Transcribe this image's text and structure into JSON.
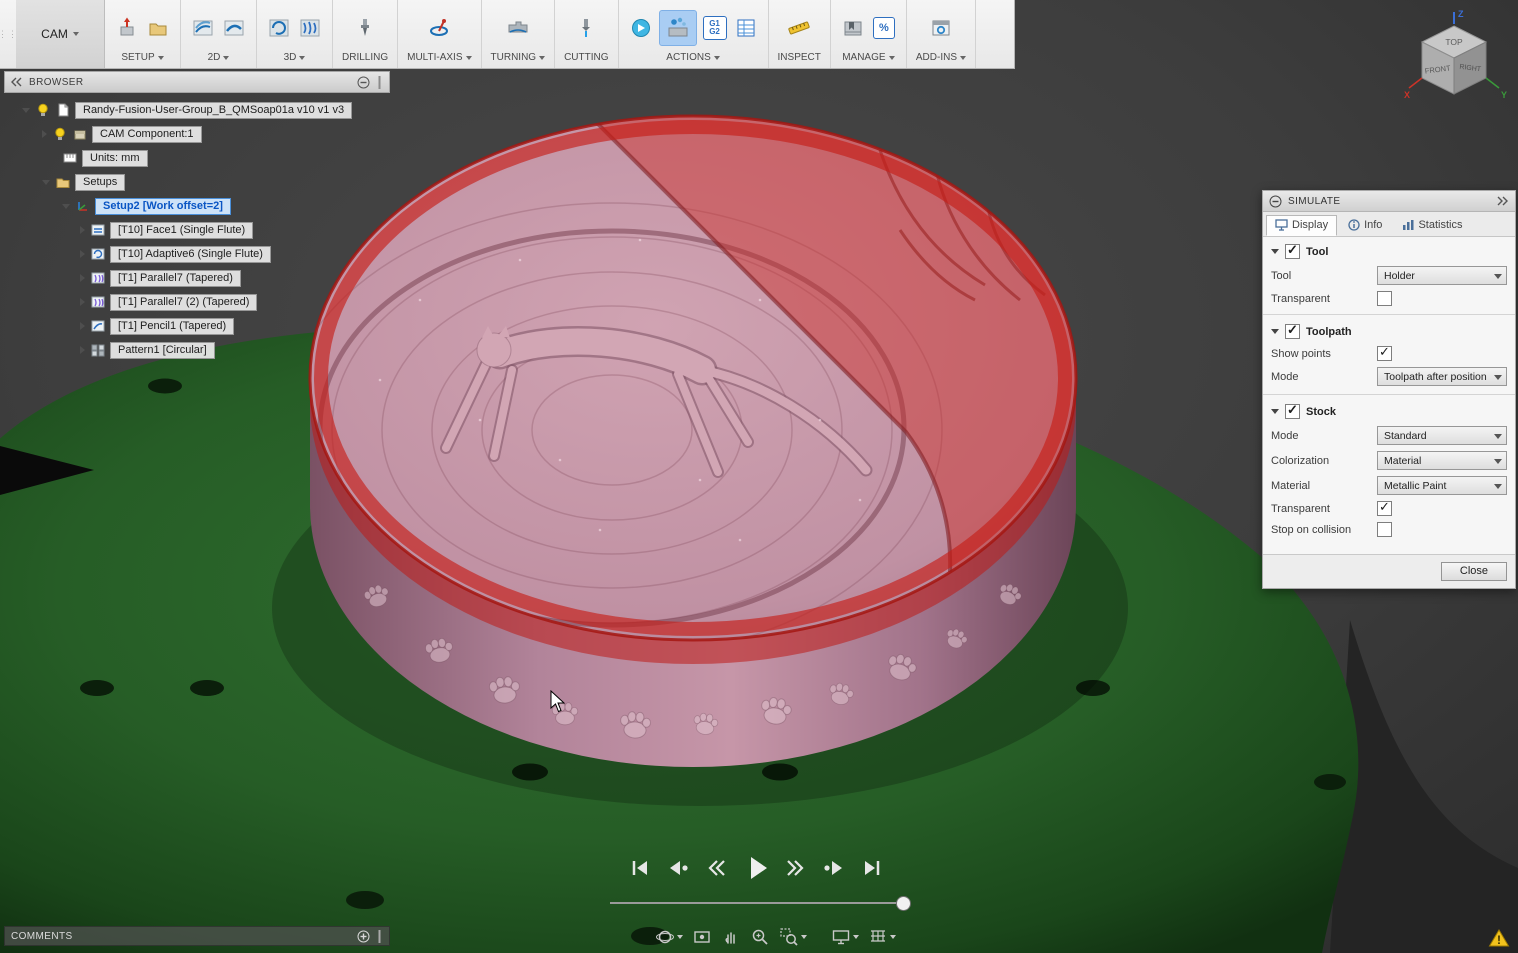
{
  "ribbon": {
    "workspace_label": "CAM",
    "groups": [
      {
        "label": "SETUP",
        "dropdown": true,
        "icons": [
          "new-setup-icon",
          "new-folder-icon"
        ]
      },
      {
        "label": "2D",
        "dropdown": true,
        "icons": [
          "2d-pocket-icon",
          "2d-contour-icon"
        ]
      },
      {
        "label": "3D",
        "dropdown": true,
        "icons": [
          "adaptive-clearing-icon",
          "parallel-icon"
        ]
      },
      {
        "label": "DRILLING",
        "dropdown": false,
        "icons": [
          "drilling-icon"
        ]
      },
      {
        "label": "MULTI-AXIS",
        "dropdown": true,
        "icons": [
          "multi-axis-icon"
        ]
      },
      {
        "label": "TURNING",
        "dropdown": true,
        "icons": [
          "turning-icon"
        ]
      },
      {
        "label": "CUTTING",
        "dropdown": false,
        "icons": [
          "cutting-icon"
        ]
      },
      {
        "label": "ACTIONS",
        "dropdown": true,
        "icons": [
          "post-process-icon",
          "simulate-icon",
          "nc-program-icon",
          "setup-sheet-icon"
        ],
        "active_icon": "simulate-icon"
      },
      {
        "label": "INSPECT",
        "dropdown": false,
        "icons": [
          "measure-icon"
        ]
      },
      {
        "label": "MANAGE",
        "dropdown": true,
        "icons": [
          "tool-library-icon",
          "feeds-speeds-icon"
        ]
      },
      {
        "label": "ADD-INS",
        "dropdown": true,
        "icons": [
          "add-ins-icon"
        ]
      }
    ],
    "icon_text": {
      "g1": "G1",
      "g2": "G2",
      "percent": "%"
    }
  },
  "browser": {
    "title": "BROWSER",
    "items": [
      {
        "label": "Randy-Fusion-User-Group_B_QMSoap01a v10 v1 v3"
      },
      {
        "label": "CAM Component:1"
      },
      {
        "label": "Units: mm"
      },
      {
        "label": "Setups"
      },
      {
        "label": "Setup2 [Work offset=2]",
        "selected": true
      },
      {
        "label": "[T10] Face1 (Single Flute)"
      },
      {
        "label": "[T10] Adaptive6 (Single Flute)"
      },
      {
        "label": "[T1] Parallel7 (Tapered)"
      },
      {
        "label": "[T1] Parallel7 (2) (Tapered)"
      },
      {
        "label": "[T1] Pencil1 (Tapered)"
      },
      {
        "label": "Pattern1 [Circular]"
      }
    ]
  },
  "simulate_panel": {
    "title": "SIMULATE",
    "tabs": [
      {
        "label": "Display"
      },
      {
        "label": "Info"
      },
      {
        "label": "Statistics"
      }
    ],
    "active_tab": "Display",
    "sections": {
      "tool": {
        "title": "Tool",
        "enabled": true,
        "rows": [
          {
            "label": "Tool",
            "value": "Holder"
          },
          {
            "label": "Transparent",
            "checked": false
          }
        ]
      },
      "toolpath": {
        "title": "Toolpath",
        "enabled": true,
        "rows": [
          {
            "label": "Show points",
            "checked": true
          },
          {
            "label": "Mode",
            "value": "Toolpath after position"
          }
        ]
      },
      "stock": {
        "title": "Stock",
        "enabled": true,
        "rows": [
          {
            "label": "Mode",
            "value": "Standard"
          },
          {
            "label": "Colorization",
            "value": "Material"
          },
          {
            "label": "Material",
            "value": "Metallic Paint"
          },
          {
            "label": "Transparent",
            "checked": true
          },
          {
            "label": "Stop on collision",
            "checked": false
          }
        ]
      }
    },
    "close_label": "Close"
  },
  "playback": {
    "buttons": [
      "skip-to-start",
      "previous-operation",
      "rewind",
      "play",
      "fast-forward",
      "next-operation",
      "skip-to-end"
    ],
    "slider_position": 0.97
  },
  "nav_toolbar": {
    "buttons": [
      "orbit",
      "look-at",
      "pan",
      "zoom",
      "zoom-window",
      "display-settings",
      "grid-settings"
    ]
  },
  "comments": {
    "title": "COMMENTS"
  },
  "viewcube": {
    "top": "TOP",
    "front": "FRONT",
    "right": "RIGHT",
    "axis_x": "X",
    "axis_y": "Y",
    "axis_z": "Z"
  },
  "warning": {
    "glyph": "!"
  },
  "colors": {
    "stock_red": "#c03028",
    "machined_pink": "#c795a6",
    "platform_green": "#2a642a",
    "selection_blue": "#0a55c4",
    "simulate_active": "#a9cdf3"
  }
}
